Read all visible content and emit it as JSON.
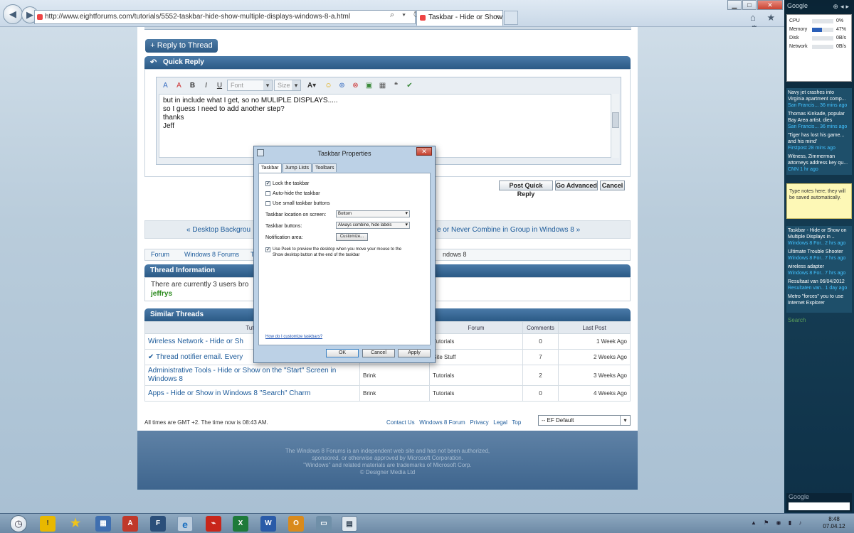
{
  "browser": {
    "url": "http://www.eightforums.com/tutorials/5552-taskbar-hide-show-multiple-displays-windows-8-a.html",
    "address_icons": "⌕ ▾ ↻",
    "tab_title": "Taskbar - Hide or Show on ...",
    "tab_close": "×",
    "back": "◀",
    "forward": "▶",
    "min": "▁",
    "max": "□",
    "close": "✕",
    "tools": "⌂ ★ ⚙"
  },
  "forum": {
    "reply_thread_label": "+ Reply to Thread",
    "quick_reply_title": "Quick Reply",
    "font_placeholder": "Font",
    "size_placeholder": "Size",
    "editor_lines": [
      "but in include what I get, so no MULIPLE DISPLAYS.....",
      "so I guess I need to add another step?",
      "",
      "thanks",
      "",
      "Jeff"
    ],
    "post_quick_reply": "Post Quick Reply",
    "go_advanced": "Go Advanced",
    "cancel": "Cancel",
    "prev_thread": "« Desktop Backgrou",
    "next_thread": "e or Never Combine in Group in Windows 8 »",
    "breadcrumb": [
      "Forum",
      "Windows 8 Forums",
      "T",
      "ndows 8"
    ],
    "thread_info_title": "Thread Information",
    "thread_info_text": "There are currently 3 users bro",
    "thread_info_user": "jeffrys",
    "similar_title": "Similar Threads",
    "table_headers": [
      "Tutor",
      "",
      "Forum",
      "Comments",
      "Last Post"
    ],
    "threads": [
      {
        "title": "Wireless Network - Hide or Sh",
        "starter": "",
        "forum": "Tutorials",
        "comments": "0",
        "last": "1 Week Ago"
      },
      {
        "title": "✔ Thread notifier email. Every",
        "starter": "",
        "forum": "Site Stuff",
        "comments": "7",
        "last": "2 Weeks Ago"
      },
      {
        "title": "Administrative Tools - Hide or Show on the \"Start\" Screen in Windows 8",
        "starter": "Brink",
        "forum": "Tutorials",
        "comments": "2",
        "last": "3 Weeks Ago"
      },
      {
        "title": "Apps - Hide or Show in Windows 8 \"Search\" Charm",
        "starter": "Brink",
        "forum": "Tutorials",
        "comments": "0",
        "last": "4 Weeks Ago"
      }
    ],
    "time_note": "All times are GMT +2. The time now is 08:43 AM.",
    "footer_links": [
      "Contact Us",
      "Windows 8 Forum",
      "Privacy",
      "Legal",
      "Top"
    ],
    "style_select": "-- EF Default",
    "disclaimer": [
      "The Windows 8 Forums is an independent web site and has not been authorized,",
      "sponsored, or otherwise approved by Microsoft Corporation.",
      "\"Windows\" and related materials are trademarks of Microsoft Corp.",
      "© Designer Media Ltd"
    ]
  },
  "dialog": {
    "title": "Taskbar Properties",
    "close": "✕",
    "tabs": [
      "Taskbar",
      "Jump Lists",
      "Toolbars"
    ],
    "lock_taskbar": "Lock the taskbar",
    "auto_hide": "Auto-hide the taskbar",
    "small_buttons": "Use small taskbar buttons",
    "location_label": "Taskbar location on screen:",
    "location_value": "Bottom",
    "buttons_label": "Taskbar buttons:",
    "buttons_value": "Always combine, hide labels",
    "notification_label": "Notification area:",
    "customize": "Customize...",
    "peek_text_1": "Use Peek to preview the desktop when you move your mouse to the",
    "peek_text_2": "Show desktop button at the end of the taskbar",
    "help_link": "How do I customize taskbars?",
    "ok": "OK",
    "cancel": "Cancel",
    "apply": "Apply",
    "lock_checked": true,
    "auto_hide_checked": false,
    "small_checked": false,
    "peek_checked": true
  },
  "sidebar": {
    "google_label": "Google",
    "meters": [
      {
        "name": "CPU",
        "value": "0%",
        "fraction": 0.0
      },
      {
        "name": "Memory",
        "value": "47%",
        "fraction": 0.47
      },
      {
        "name": "Disk",
        "value": "0B/s",
        "fraction": 0.0
      },
      {
        "name": "Network",
        "value": "0B/s",
        "fraction": 0.0
      }
    ],
    "news": [
      {
        "title": "Navy jet crashes into Virginia apartment comp...",
        "source": "San Francis... 36 mins ago"
      },
      {
        "title": "Thomas Kinkade, popular Bay Area artist, dies",
        "source": "San Francis... 36 mins ago"
      },
      {
        "title": "'Tiger has lost his game... and his mind'",
        "source": "Firstpost 28 mins ago"
      },
      {
        "title": "Witness, Zimmerman attorneys address key qu...",
        "source": "CNN 1 hr ago"
      }
    ],
    "note": "Type notes here; they will be saved automatically.",
    "feeds": [
      {
        "title": "Taskbar - Hide or Show on Multiple Displays in ..",
        "source": "Windows 8 For.. 2 hrs ago"
      },
      {
        "title": "Ultimate Trouble Shooter",
        "source": "Windows 8 For.. 7 hrs ago"
      },
      {
        "title": "wireless adapter",
        "source": "Windows 8 For.. 7 hrs ago"
      },
      {
        "title": "Resultaat van 06/04/2012",
        "source": "Resultaten van.. 1 day ago"
      },
      {
        "title": "Metro \"forces\" you to use Internet Explorer",
        "source": ""
      }
    ],
    "search_label": "Search",
    "google_bottom": "Google"
  },
  "taskbar": {
    "time": "8:48",
    "date": "07.04.12",
    "tray_icons": "▲ ⚑ ◉ ▮ ♪"
  }
}
